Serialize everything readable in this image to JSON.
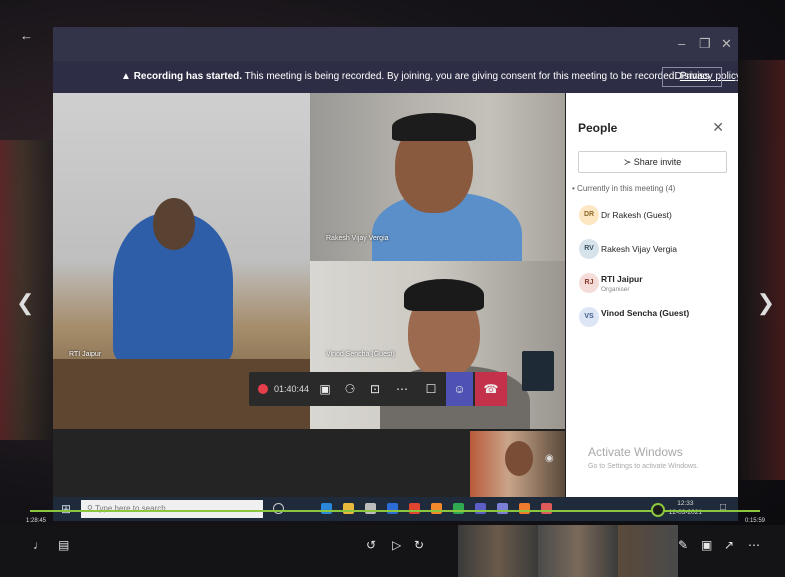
{
  "viewer": {
    "back_icon": "arrow-left-icon",
    "prev_icon": "chevron-left-icon",
    "next_icon": "chevron-right-icon"
  },
  "window": {
    "controls": [
      "–",
      "❐",
      "✕"
    ]
  },
  "banner": {
    "bold": "Recording has started.",
    "text": " This meeting is being recorded. By joining, you are giving consent for this meeting to be recorded. ",
    "link": "Privacy policy",
    "dismiss": "Dismiss"
  },
  "tiles": {
    "main_name": "RTI Jaipur",
    "top_right_name": "Rakesh Vijay Vergia",
    "mid_right_name": "Vinod Sencha (Guest)"
  },
  "call_toolbar": {
    "timer": "01:40:44"
  },
  "people_panel": {
    "title": "People",
    "share": "Share invite",
    "in_meeting": "Currently in this meeting (4)",
    "participants": [
      {
        "initials": "DR",
        "name": "Dr Rakesh (Guest)",
        "role": "",
        "color": "#fde7c2",
        "text_color": "#8a6a2a"
      },
      {
        "initials": "RV",
        "name": "Rakesh Vijay Vergia",
        "role": "",
        "color": "#d6e3ea",
        "text_color": "#3b5566"
      },
      {
        "initials": "RJ",
        "name": "RTI Jaipur",
        "role": "Organiser",
        "color": "#f4dcd8",
        "text_color": "#8a3b2f"
      },
      {
        "initials": "VS",
        "name": "Vinod Sencha (Guest)",
        "role": "",
        "color": "#dde6f4",
        "text_color": "#3c5a8a"
      }
    ],
    "activate_title": "Activate Windows",
    "activate_sub": "Go to Settings to activate Windows."
  },
  "taskbar": {
    "search_placeholder": "Type here to search",
    "time": "12:33",
    "date": "12-03-2021"
  },
  "player": {
    "elapsed": "1:28:45",
    "remaining": "0:15:59",
    "progress": 0.85
  }
}
